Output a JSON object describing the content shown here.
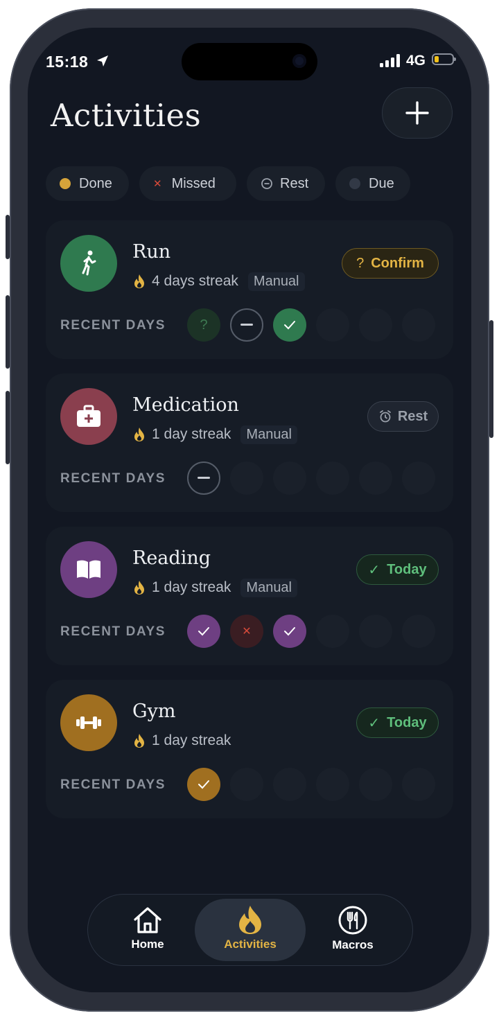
{
  "status_bar": {
    "time": "15:18",
    "network": "4G"
  },
  "header": {
    "title": "Activities"
  },
  "legend": [
    {
      "label": "Done",
      "dot_color": "#d6a43a"
    },
    {
      "label": "Missed",
      "dot_color": "#c0392b"
    },
    {
      "label": "Rest",
      "dot_color": "#8a8f99"
    },
    {
      "label": "Due",
      "dot_color": "#3a404c"
    }
  ],
  "section_label": "RECENT DAYS",
  "activities": [
    {
      "name": "Run",
      "icon": "walking-person-icon",
      "color": "#2f7a4f",
      "streak": "4 days streak",
      "tag": "Manual",
      "action": "Confirm",
      "action_icon": "?",
      "recent_days": [
        "pending",
        "rest",
        "done",
        "empty",
        "empty",
        "empty"
      ]
    },
    {
      "name": "Medication",
      "icon": "first-aid-kit-icon",
      "color": "#8a3f4e",
      "streak": "1 day streak",
      "tag": "Manual",
      "action": "Rest",
      "action_icon": "alarm-clock-icon",
      "recent_days": [
        "rest",
        "empty",
        "empty",
        "empty",
        "empty",
        "empty"
      ]
    },
    {
      "name": "Reading",
      "icon": "open-book-icon",
      "color": "#6e3f82",
      "streak": "1 day streak",
      "tag": "Manual",
      "action": "Today",
      "action_icon": "✓",
      "recent_days": [
        "done",
        "missed",
        "done",
        "empty",
        "empty",
        "empty"
      ]
    },
    {
      "name": "Gym",
      "icon": "dumbbell-icon",
      "color": "#a06f20",
      "streak": "1 day streak",
      "tag": "",
      "action": "Today",
      "action_icon": "✓",
      "recent_days": [
        "done",
        "empty",
        "empty",
        "empty",
        "empty",
        "empty"
      ]
    }
  ],
  "nav": [
    {
      "label": "Home",
      "icon": "home-icon",
      "active": false
    },
    {
      "label": "Activities",
      "icon": "flame-icon",
      "active": true
    },
    {
      "label": "Macros",
      "icon": "fork-knife-icon",
      "active": false
    }
  ],
  "colors": {
    "accent_gold": "#e3b444",
    "today_green": "#5fbf7c",
    "confirm_gold": "#d6a43a"
  }
}
